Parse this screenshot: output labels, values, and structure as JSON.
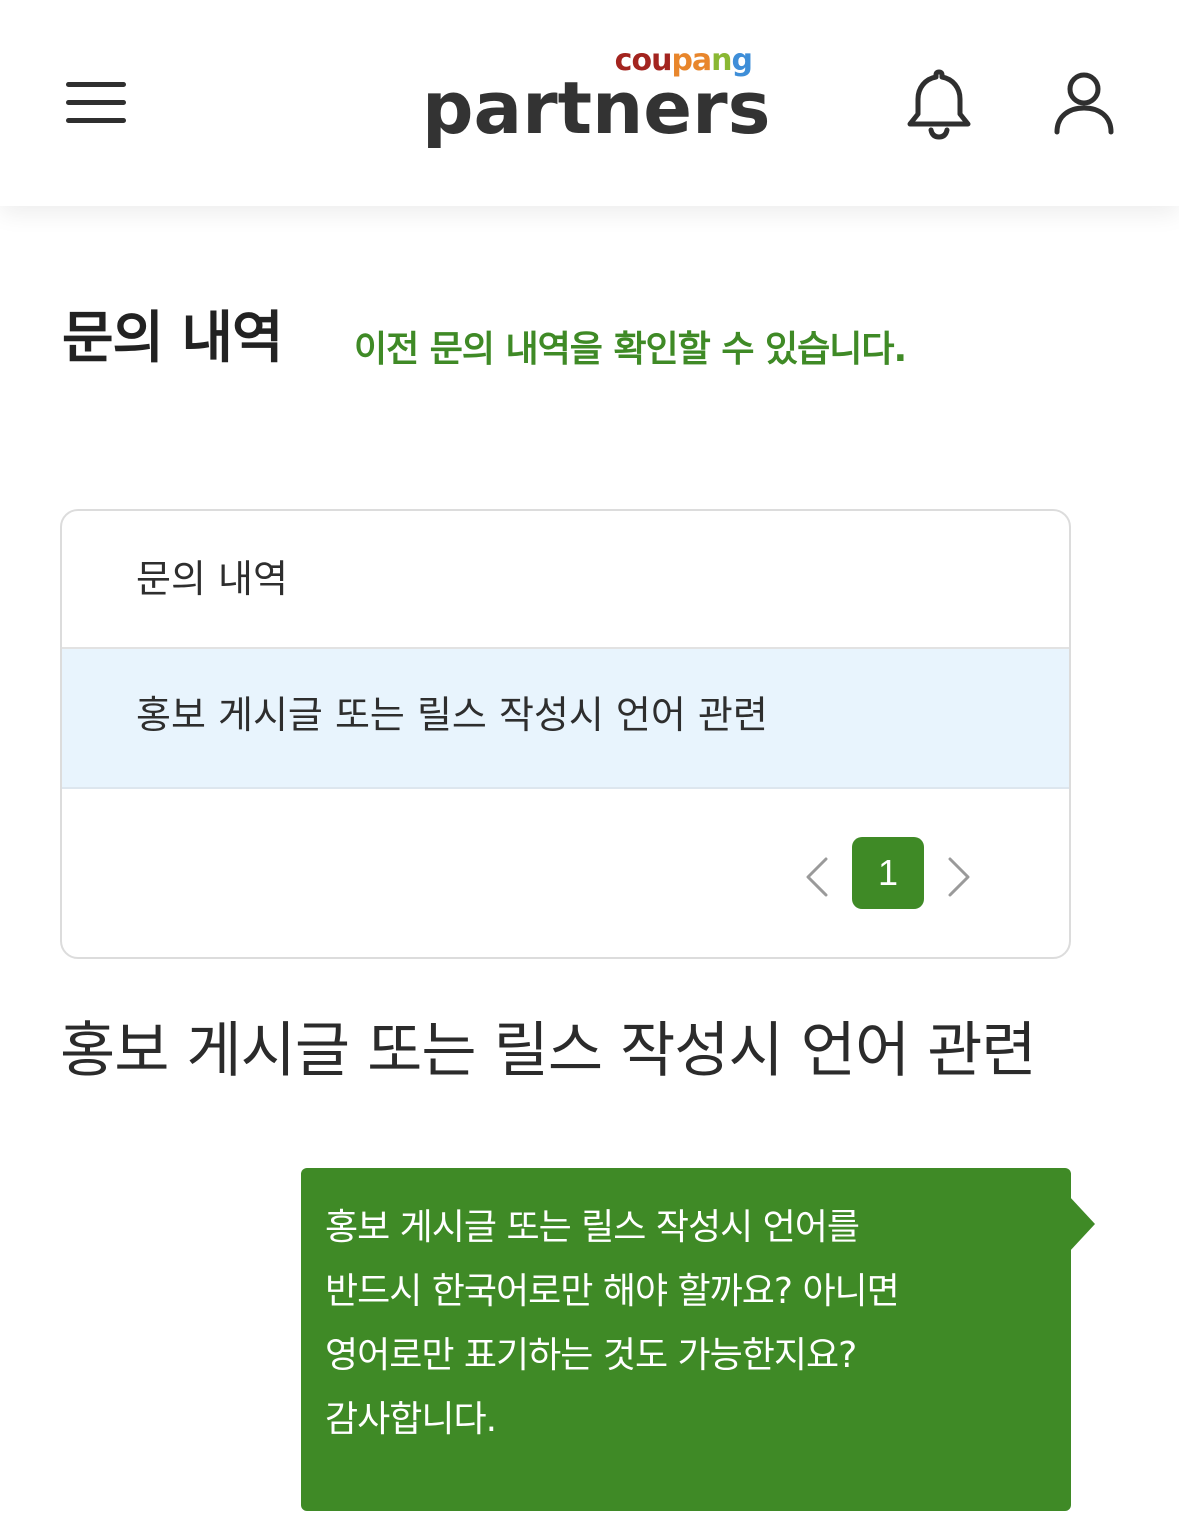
{
  "header": {
    "logo_top": "coupang",
    "logo_main": "partners"
  },
  "page": {
    "title": "문의 내역",
    "subtitle": "이전 문의 내역을 확인할 수 있습니다."
  },
  "list": {
    "header_label": "문의 내역",
    "items": [
      {
        "title": "홍보 게시글 또는 릴스 작성시 언어 관련"
      }
    ],
    "pagination": {
      "current_page": "1"
    }
  },
  "detail": {
    "title": "홍보 게시글 또는 릴스 작성시 언어 관련",
    "message_lines": [
      "홍보 게시글 또는 릴스 작성시 언어를",
      "반드시 한국어로만 해야 할까요? 아니면",
      "영어로만 표기하는 것도 가능한지요?",
      "감사합니다."
    ]
  },
  "colors": {
    "accent_green": "#3f8a26",
    "selected_row_bg": "#e8f4fd",
    "logo_letters": [
      "#a3241f",
      "#e8862c",
      "#8ab833",
      "#3e8ed8"
    ]
  },
  "icons": {
    "menu": "hamburger-menu-icon",
    "notifications": "bell-icon",
    "profile": "user-icon",
    "prev": "chevron-left-icon",
    "next": "chevron-right-icon"
  }
}
